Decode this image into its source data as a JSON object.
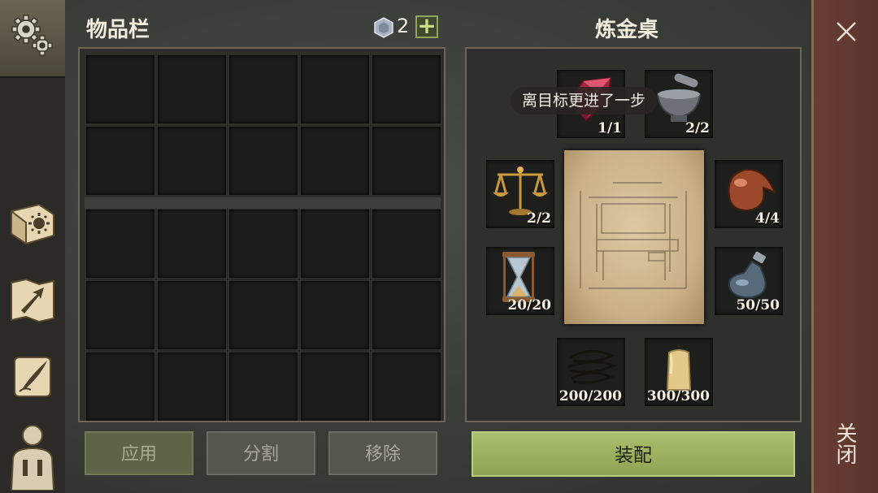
{
  "inventory": {
    "title": "物品栏",
    "gem_count": "2",
    "plus_label": "+",
    "buttons": {
      "apply": "应用",
      "split": "分割",
      "remove": "移除"
    }
  },
  "alchemy": {
    "title": "炼金桌",
    "tooltip": "离目标更进了一步",
    "slots": {
      "gem": "1/1",
      "mortar": "2/2",
      "scales": "2/2",
      "copper": "4/4",
      "hourglass": "20/20",
      "flask": "50/50",
      "rope": "200/200",
      "candle": "300/300"
    },
    "equip_label": "装配"
  },
  "close": {
    "label": "关闭"
  },
  "colors": {
    "accent_green": "#a9bf6e",
    "close_red": "#6a3d33"
  },
  "icons": [
    "gears-icon",
    "sun-book-icon",
    "map-arrow-icon",
    "scroll-quill-icon",
    "character-icon",
    "gem-currency-icon",
    "close-icon"
  ]
}
